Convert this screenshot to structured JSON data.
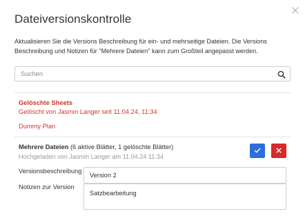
{
  "dialog": {
    "title": "Dateiversionskontrolle",
    "intro": "Aktualisieren Sie die Versions Beschreibung für ein- und mehrseitige Dateien. Die Versions Beschreibung und Notizen für \"Mehrere Dateien\" kann zum Großteil angepasst werden."
  },
  "search": {
    "placeholder": "Suchen",
    "icon": "search-icon"
  },
  "deleted": {
    "heading": "Gelöschte Sheets",
    "meta": "Gelöscht von Jasmin Langer seit 11.04.24, 11:34",
    "items": [
      "Dummy Plan"
    ],
    "color": "#d0342c"
  },
  "multiple": {
    "name": "Mehrere Dateien",
    "details": "(6 aktive Blätter, 1 gelöschte Blätter)",
    "meta": "Hochgeladen von Jasmin Langer am 11.04.24 11:34",
    "confirm_icon": "check-icon",
    "cancel_icon": "x-icon",
    "confirm_color": "#2a6fdb",
    "cancel_color": "#d52b2b"
  },
  "form": {
    "version_label": "Versionsbeschreibung",
    "version_value": "Version 2",
    "notes_label": "Notizen zur Version",
    "notes_value": "Satzbearbeitung"
  }
}
